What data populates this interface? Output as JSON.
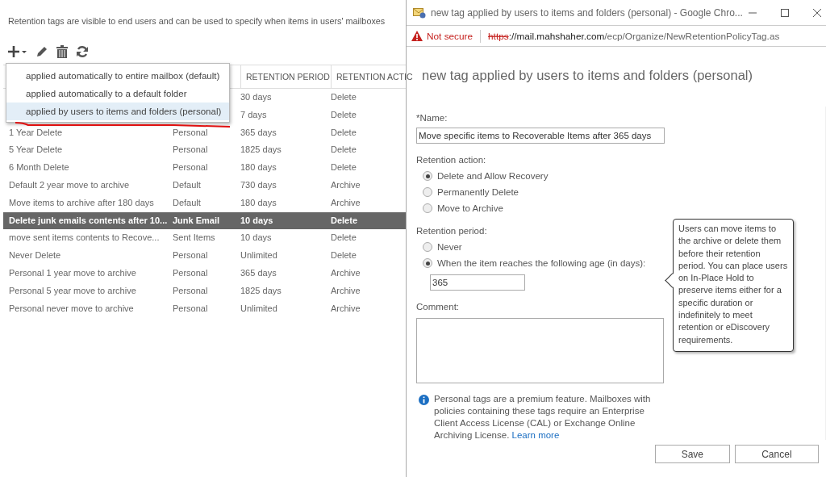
{
  "description": "Retention tags are visible to end users and can be used to specify when items in users' mailboxes",
  "add_menu": {
    "items": [
      {
        "label": "applied automatically to entire mailbox (default)",
        "selected": false
      },
      {
        "label": "applied automatically to a default folder",
        "selected": false
      },
      {
        "label": "applied by users to items and folders (personal)",
        "selected": true
      }
    ]
  },
  "table": {
    "columns": [
      "RETENTION PERIOD",
      "RETENTION ACTIC"
    ],
    "rows": [
      {
        "period": "30 days",
        "action": "Delete",
        "selected": false
      },
      {
        "period": "7 days",
        "action": "Delete",
        "selected": false
      },
      {
        "name": "1 Year Delete",
        "type": "Personal",
        "period": "365 days",
        "action": "Delete",
        "selected": false
      },
      {
        "name": "5 Year Delete",
        "type": "Personal",
        "period": "1825 days",
        "action": "Delete",
        "selected": false
      },
      {
        "name": "6 Month Delete",
        "type": "Personal",
        "period": "180 days",
        "action": "Delete",
        "selected": false
      },
      {
        "name": "Default 2 year move to archive",
        "type": "Default",
        "period": "730 days",
        "action": "Archive",
        "selected": false
      },
      {
        "name": "Move items to archive after 180 days",
        "type": "Default",
        "period": "180 days",
        "action": "Archive",
        "selected": false
      },
      {
        "name": "Delete junk emails contents after 10...",
        "type": "Junk Email",
        "period": "10 days",
        "action": "Delete",
        "selected": true
      },
      {
        "name": "move sent items contents to Recove...",
        "type": "Sent Items",
        "period": "10 days",
        "action": "Delete",
        "selected": false
      },
      {
        "name": "Never Delete",
        "type": "Personal",
        "period": "Unlimited",
        "action": "Delete",
        "selected": false
      },
      {
        "name": "Personal 1 year move to archive",
        "type": "Personal",
        "period": "365 days",
        "action": "Archive",
        "selected": false
      },
      {
        "name": "Personal 5 year move to archive",
        "type": "Personal",
        "period": "1825 days",
        "action": "Archive",
        "selected": false
      },
      {
        "name": "Personal never move to archive",
        "type": "Personal",
        "period": "Unlimited",
        "action": "Archive",
        "selected": false
      }
    ]
  },
  "browser": {
    "title": "new tag applied by users to items and folders (personal) - Google Chro...",
    "security": "Not secure",
    "url_scheme": "https",
    "url_host": "://mail.mahshaher.com",
    "url_path": "/ecp/Organize/NewRetentionPolicyTag.as"
  },
  "dialog": {
    "heading": "new tag applied by users to items and folders (personal)",
    "name_label": "*Name:",
    "name_value": "Move specific items to Recoverable Items after 365 days",
    "action_label": "Retention action:",
    "action_options": [
      {
        "label": "Delete and Allow Recovery",
        "selected": true
      },
      {
        "label": "Permanently Delete",
        "selected": false
      },
      {
        "label": "Move to Archive",
        "selected": false
      }
    ],
    "period_label": "Retention period:",
    "period_options": [
      {
        "label": "Never",
        "selected": false
      },
      {
        "label": "When the item reaches the following age (in days):",
        "selected": true
      }
    ],
    "days_value": "365",
    "comment_label": "Comment:",
    "notice": "Personal tags are a premium feature. Mailboxes with policies containing these tags require an Enterprise Client Access License (CAL) or Exchange Online Archiving License.",
    "learn_more": "Learn more",
    "tooltip": "Users can move items to the archive or delete them before their retention period. You can place users on In-Place Hold to preserve items either for a specific duration or indefinitely to meet retention or eDiscovery requirements.",
    "buttons": [
      "Save",
      "Cancel"
    ]
  }
}
